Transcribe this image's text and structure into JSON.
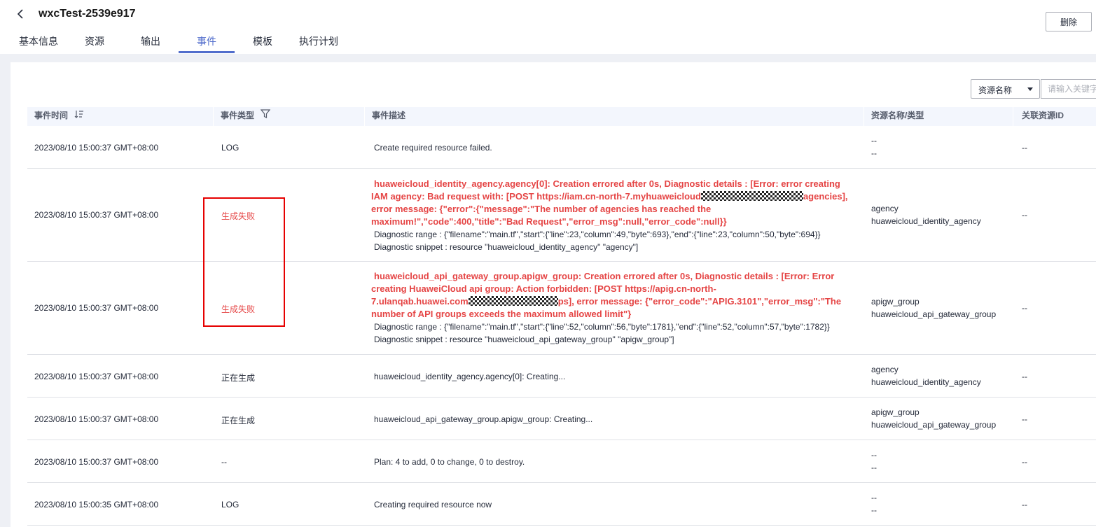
{
  "header": {
    "title": "wxcTest-2539e917",
    "delete_label": "删除",
    "tabs": [
      {
        "label": "基本信息",
        "active": false
      },
      {
        "label": "资源",
        "active": false
      },
      {
        "label": "输出",
        "active": false
      },
      {
        "label": "事件",
        "active": true
      },
      {
        "label": "模板",
        "active": false
      },
      {
        "label": "执行计划",
        "active": false
      }
    ]
  },
  "filter": {
    "select_value": "资源名称",
    "search_placeholder": "请输入关键字"
  },
  "table": {
    "columns": [
      "事件时间",
      "事件类型",
      "事件描述",
      "资源名称/类型",
      "关联资源ID"
    ],
    "rows": [
      {
        "time": "2023/08/10 15:00:37 GMT+08:00",
        "type": "LOG",
        "desc": "Create required resource failed.",
        "res_name": "--",
        "res_type": "--",
        "res_id": "--"
      },
      {
        "time": "2023/08/10 15:00:37 GMT+08:00",
        "type": "生成失败",
        "err_line1": "huaweicloud_identity_agency.agency[0]: Creation errored after 0s, Diagnostic details : [Error: error creating",
        "err_line2a": "IAM agency: Bad request with: [POST https://iam.cn-north-7.myhuaweicloud",
        "err_line2b": "agencies],",
        "err_line3": "error message: {\"error\":{\"message\":\"The number of agencies has reached the",
        "err_line4": "maximum!\",\"code\":400,\"title\":\"Bad Request\",\"error_msg\":null,\"error_code\":null}}",
        "diag_range": "Diagnostic range : {\"filename\":\"main.tf\",\"start\":{\"line\":23,\"column\":49,\"byte\":693},\"end\":{\"line\":23,\"column\":50,\"byte\":694}}",
        "diag_snippet": "Diagnostic snippet : resource \"huaweicloud_identity_agency\" \"agency\"]",
        "res_name": "agency",
        "res_type": "huaweicloud_identity_agency",
        "res_id": "--"
      },
      {
        "time": "2023/08/10 15:00:37 GMT+08:00",
        "type": "生成失败",
        "err_line1": "huaweicloud_api_gateway_group.apigw_group: Creation errored after 0s, Diagnostic details : [Error: Error",
        "err_line2": "creating HuaweiCloud api group: Action forbidden: [POST https://apig.cn-north-",
        "err_line3a": "7.ulanqab.huawei.com",
        "err_line3b": "ps], error message: {\"error_code\":\"APIG.3101\",\"error_msg\":\"The",
        "err_line4": "number of API groups exceeds the maximum allowed limit\"}",
        "diag_range": "Diagnostic range : {\"filename\":\"main.tf\",\"start\":{\"line\":52,\"column\":56,\"byte\":1781},\"end\":{\"line\":52,\"column\":57,\"byte\":1782}}",
        "diag_snippet": "Diagnostic snippet : resource \"huaweicloud_api_gateway_group\" \"apigw_group\"]",
        "res_name": "apigw_group",
        "res_type": "huaweicloud_api_gateway_group",
        "res_id": "--"
      },
      {
        "time": "2023/08/10 15:00:37 GMT+08:00",
        "type": "正在生成",
        "desc": "huaweicloud_identity_agency.agency[0]: Creating...",
        "res_name": "agency",
        "res_type": "huaweicloud_identity_agency",
        "res_id": "--"
      },
      {
        "time": "2023/08/10 15:00:37 GMT+08:00",
        "type": "正在生成",
        "desc": "huaweicloud_api_gateway_group.apigw_group: Creating...",
        "res_name": "apigw_group",
        "res_type": "huaweicloud_api_gateway_group",
        "res_id": "--"
      },
      {
        "time": "2023/08/10 15:00:37 GMT+08:00",
        "type": "--",
        "desc": "Plan: 4 to add, 0 to change, 0 to destroy.",
        "res_name": "--",
        "res_type": "--",
        "res_id": "--"
      },
      {
        "time": "2023/08/10 15:00:35 GMT+08:00",
        "type": "LOG",
        "desc": "Creating required resource now",
        "res_name": "--",
        "res_type": "--",
        "res_id": "--"
      }
    ]
  },
  "colors": {
    "accent": "#526ecc",
    "error": "#e54545",
    "highlight_box": "#e60000"
  }
}
